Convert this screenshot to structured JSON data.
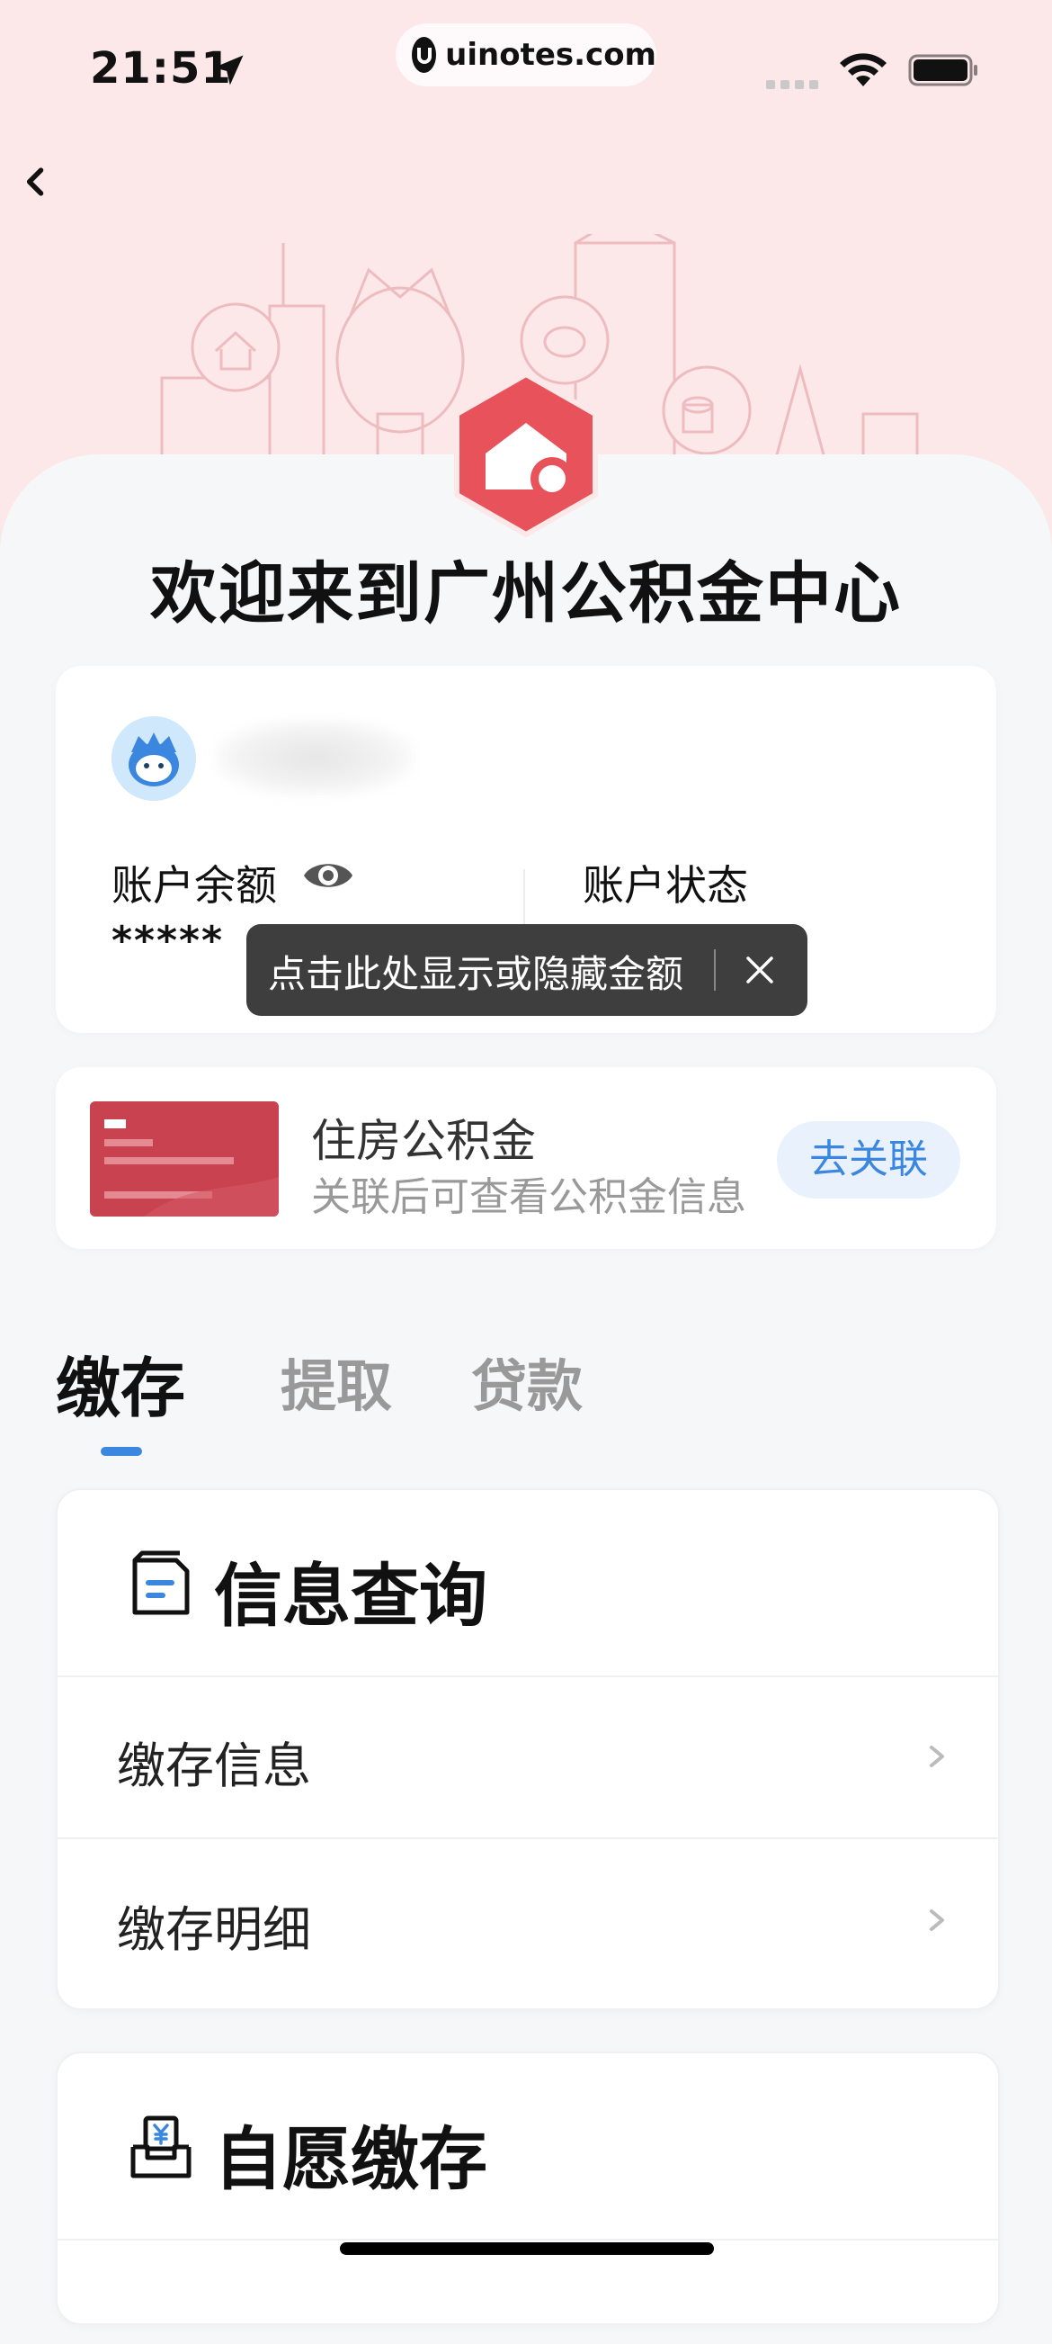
{
  "status_bar": {
    "time": "21:51",
    "url": "uinotes.com"
  },
  "header": {
    "welcome": "欢迎来到广州公积金中心"
  },
  "account": {
    "balance_label": "账户余额",
    "balance_value": "*****",
    "status_label": "账户状态",
    "tooltip": "点击此处显示或隐藏金额"
  },
  "fund_card": {
    "title": "住房公积金",
    "subtitle": "关联后可查看公积金信息",
    "button": "去关联"
  },
  "tabs": [
    {
      "label": "缴存",
      "active": true
    },
    {
      "label": "提取",
      "active": false
    },
    {
      "label": "贷款",
      "active": false
    }
  ],
  "info_section": {
    "title": "信息查询",
    "rows": [
      {
        "label": "缴存信息"
      },
      {
        "label": "缴存明细"
      }
    ]
  },
  "voluntary_section": {
    "title": "自愿缴存"
  },
  "colors": {
    "accent_blue": "#3b87e0",
    "brand_red": "#e8525a",
    "header_pink": "#fce8e9"
  }
}
